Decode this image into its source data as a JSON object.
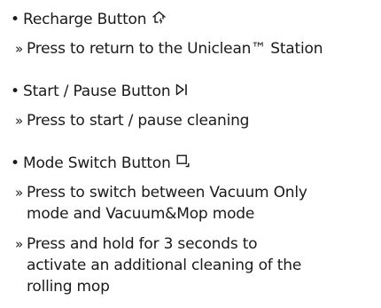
{
  "items": [
    {
      "title": "Recharge Button",
      "icon": "recharge-icon",
      "descriptions": [
        "Press to return to the Uniclean™ Station"
      ]
    },
    {
      "title": "Start / Pause Button",
      "icon": "start-pause-icon",
      "descriptions": [
        "Press to start / pause cleaning"
      ]
    },
    {
      "title": "Mode Switch Button",
      "icon": "mode-switch-icon",
      "descriptions": [
        "Press to switch between Vacuum Only mode and Vacuum&Mop mode",
        "Press and hold for 3 seconds to activate an additional cleaning of the rolling mop"
      ]
    }
  ],
  "bullet_char": "•",
  "desc_marker": "»"
}
